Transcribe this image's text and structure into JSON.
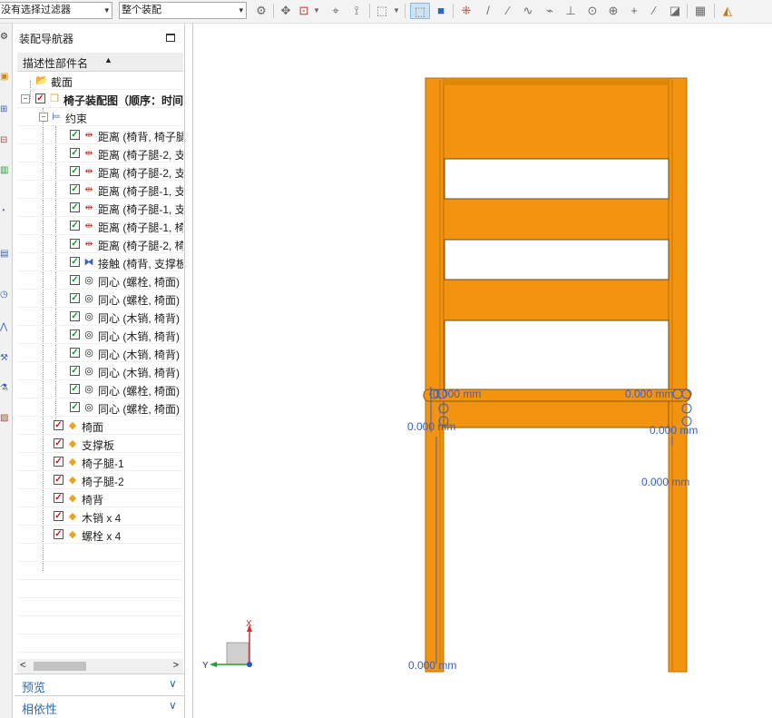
{
  "toolbar": {
    "filter_combo": "没有选择过滤器",
    "scope_combo": "整个装配",
    "combo_arrow": "▾"
  },
  "navigator": {
    "title": "装配导航器",
    "column_header": "描述性部件名",
    "sort_indicator": "▲",
    "rows": [
      {
        "label": "截面",
        "icon": "folder-icon",
        "check": "",
        "indent": 1
      },
      {
        "label": "椅子装配图（顺序：时间",
        "icon": "assembly-icon",
        "check": "red",
        "indent": 0,
        "bold": true
      },
      {
        "label": "约束",
        "icon": "constraint-group-icon",
        "check": "",
        "indent": 2
      },
      {
        "label": "距离 (椅背, 椅子腿",
        "icon": "distance-icon",
        "check": "green",
        "indent": 3
      },
      {
        "label": "距离 (椅子腿-2, 支",
        "icon": "distance-icon",
        "check": "green",
        "indent": 3
      },
      {
        "label": "距离 (椅子腿-2, 支",
        "icon": "distance-icon",
        "check": "green",
        "indent": 3
      },
      {
        "label": "距离 (椅子腿-1, 支",
        "icon": "distance-icon",
        "check": "green",
        "indent": 3
      },
      {
        "label": "距离 (椅子腿-1, 支",
        "icon": "distance-icon",
        "check": "green",
        "indent": 3
      },
      {
        "label": "距离 (椅子腿-1, 椅",
        "icon": "distance-icon",
        "check": "green",
        "indent": 3
      },
      {
        "label": "距离 (椅子腿-2, 椅",
        "icon": "distance-icon",
        "check": "green",
        "indent": 3
      },
      {
        "label": "接触 (椅背, 支撑板",
        "icon": "touch-icon",
        "check": "green",
        "indent": 3
      },
      {
        "label": "同心 (螺栓, 椅面)",
        "icon": "concentric-icon",
        "check": "green",
        "indent": 3
      },
      {
        "label": "同心 (螺栓, 椅面)",
        "icon": "concentric-icon",
        "check": "green",
        "indent": 3
      },
      {
        "label": "同心 (木销, 椅背)",
        "icon": "concentric-icon",
        "check": "green",
        "indent": 3
      },
      {
        "label": "同心 (木销, 椅背)",
        "icon": "concentric-icon",
        "check": "green",
        "indent": 3
      },
      {
        "label": "同心 (木销, 椅背)",
        "icon": "concentric-icon",
        "check": "green",
        "indent": 3
      },
      {
        "label": "同心 (木销, 椅背)",
        "icon": "concentric-icon",
        "check": "green",
        "indent": 3
      },
      {
        "label": "同心 (螺栓, 椅面)",
        "icon": "concentric-icon",
        "check": "green",
        "indent": 3
      },
      {
        "label": "同心 (螺栓, 椅面)",
        "icon": "concentric-icon",
        "check": "green",
        "indent": 3
      },
      {
        "label": "椅面",
        "icon": "part-icon",
        "check": "red",
        "indent": 2
      },
      {
        "label": "支撑板",
        "icon": "part-icon",
        "check": "red",
        "indent": 2
      },
      {
        "label": "椅子腿-1",
        "icon": "part-icon",
        "check": "red",
        "indent": 2
      },
      {
        "label": "椅子腿-2",
        "icon": "part-icon",
        "check": "red",
        "indent": 2
      },
      {
        "label": "椅背",
        "icon": "part-icon",
        "check": "red",
        "indent": 2
      },
      {
        "label": "木销 x 4",
        "icon": "part-icon",
        "check": "red",
        "indent": 2
      },
      {
        "label": "螺栓 x 4",
        "icon": "part-icon",
        "check": "red",
        "indent": 2
      }
    ],
    "scroll_left": "<",
    "scroll_right": ">",
    "panels": [
      {
        "label": "预览",
        "chevron": "∨"
      },
      {
        "label": "相依性",
        "chevron": "∨"
      }
    ]
  },
  "viewport": {
    "dimensions": [
      "0.000 mm",
      "0.000 mm",
      "0.000 mm",
      "0.000 mm",
      "0.000 mm",
      "0.000 mm"
    ],
    "triad": {
      "x_label": "X",
      "y_label": "Y"
    },
    "colors": {
      "chair": "#f39410",
      "chair_dark": "#c97506",
      "dim": "#3a5fbf",
      "triad_x": "#d43030",
      "triad_y": "#2a9a3a",
      "triad_z": "#2a55c8"
    }
  }
}
